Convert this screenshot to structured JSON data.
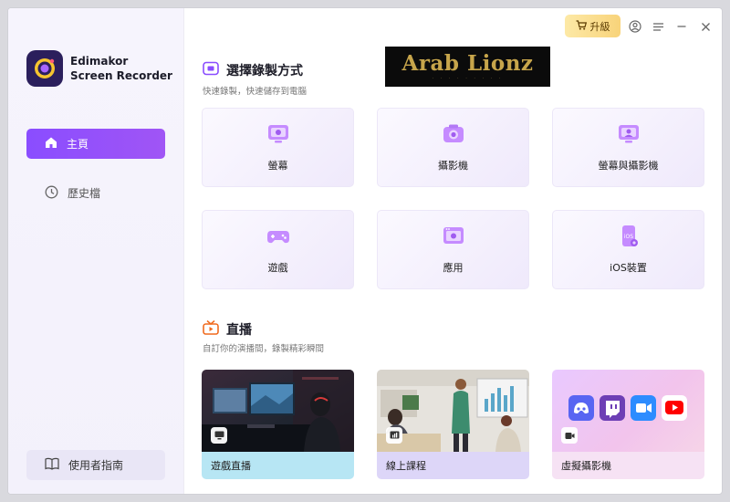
{
  "app": {
    "name_line1": "Edimakor",
    "name_line2": "Screen Recorder"
  },
  "sidebar": {
    "items": [
      {
        "label": "主頁",
        "icon": "home-icon",
        "active": true
      },
      {
        "label": "歷史檔",
        "icon": "clock-icon",
        "active": false
      }
    ],
    "guide_label": "使用者指南"
  },
  "titlebar": {
    "upgrade_label": "升級"
  },
  "banner": {
    "title": "Arab Lionz"
  },
  "record": {
    "title": "選擇錄製方式",
    "subtitle": "快速錄製，快速儲存到電腦",
    "cards": [
      {
        "label": "螢幕",
        "icon": "screen-icon"
      },
      {
        "label": "攝影機",
        "icon": "camera-icon"
      },
      {
        "label": "螢幕與攝影機",
        "icon": "screen-camera-icon"
      },
      {
        "label": "遊戲",
        "icon": "gamepad-icon"
      },
      {
        "label": "應用",
        "icon": "app-window-icon"
      },
      {
        "label": "iOS裝置",
        "icon": "ios-device-icon"
      }
    ]
  },
  "live": {
    "title": "直播",
    "subtitle": "自訂你的演播間，錄製精彩瞬間",
    "cards": [
      {
        "label": "遊戲直播",
        "icon": "monitor-icon"
      },
      {
        "label": "線上課程",
        "icon": "presentation-icon"
      },
      {
        "label": "虛擬攝影機",
        "icon": "video-camera-icon"
      }
    ]
  },
  "colors": {
    "accent": "#8a4dff",
    "upgrade": "#f8d37a",
    "live_icon": "#f06a1e"
  }
}
